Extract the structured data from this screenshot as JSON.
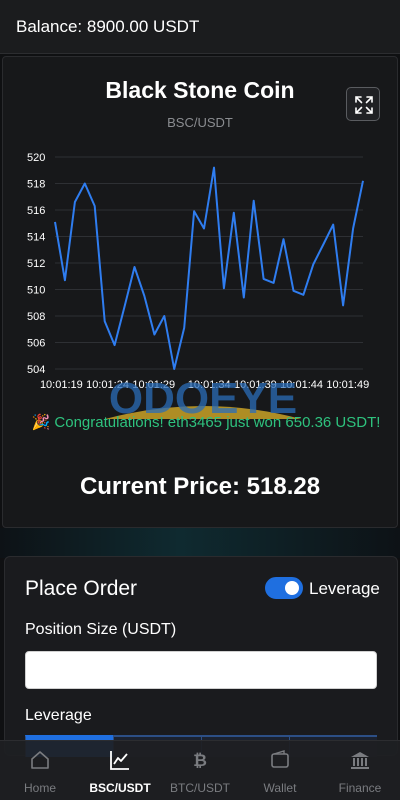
{
  "header": {
    "balance_text": "Balance: 8900.00 USDT"
  },
  "market": {
    "coin_name": "Black Stone Coin",
    "pair": "BSC/USDT",
    "expand_icon": "expand-icon",
    "current_price_text": "Current Price: 518.28"
  },
  "watermark": {
    "text": "ODOEYE"
  },
  "notification": {
    "icon": "party-popper",
    "text": "Congratulations! eth3465 just won 650.36 USDT!"
  },
  "chart_data": {
    "type": "line",
    "x": [
      "10:01:19",
      "10:01:20",
      "10:01:21",
      "10:01:22",
      "10:01:23",
      "10:01:24",
      "10:01:25",
      "10:01:26",
      "10:01:27",
      "10:01:28",
      "10:01:29",
      "10:01:30",
      "10:01:31",
      "10:01:32",
      "10:01:33",
      "10:01:34",
      "10:01:35",
      "10:01:36",
      "10:01:37",
      "10:01:38",
      "10:01:39",
      "10:01:40",
      "10:01:41",
      "10:01:42",
      "10:01:43",
      "10:01:44",
      "10:01:45",
      "10:01:46",
      "10:01:47",
      "10:01:48",
      "10:01:49"
    ],
    "series": [
      {
        "values": [
          515.1,
          510.7,
          516.6,
          518.0,
          516.3,
          507.6,
          505.8,
          508.7,
          511.7,
          509.5,
          506.6,
          508.0,
          504.0,
          507.1,
          515.9,
          514.6,
          519.2,
          510.1,
          515.8,
          509.4,
          516.7,
          510.8,
          510.5,
          513.8,
          509.9,
          509.6,
          511.9,
          513.4,
          514.9,
          508.8,
          514.6,
          518.2
        ]
      }
    ],
    "x_tick_labels": [
      "10:01:19",
      "10:01:24",
      "10:01:29",
      "10:01:34",
      "10:01:39",
      "10:01:44",
      "10:01:49"
    ],
    "y_ticks": [
      504,
      506,
      508,
      510,
      512,
      514,
      516,
      518,
      520
    ],
    "ylim": [
      504,
      520
    ],
    "line_color": "#2f7df0",
    "grid": true
  },
  "order": {
    "title": "Place Order",
    "leverage_toggle_label": "Leverage",
    "leverage_enabled": true,
    "position_size_label": "Position Size (USDT)",
    "position_size_value": "",
    "leverage_label": "Leverage",
    "leverage_options_count": 4
  },
  "nav": {
    "items": [
      {
        "label": "Home",
        "icon": "home-icon"
      },
      {
        "label": "BSC/USDT",
        "icon": "chart-line-icon",
        "active": true
      },
      {
        "label": "BTC/USDT",
        "icon": "bitcoin-icon"
      },
      {
        "label": "Wallet",
        "icon": "wallet-icon"
      },
      {
        "label": "Finance",
        "icon": "bank-icon"
      }
    ]
  },
  "colors": {
    "accent": "#1f6fe0",
    "success_text": "#2ec27e",
    "background": "#0f1012"
  }
}
